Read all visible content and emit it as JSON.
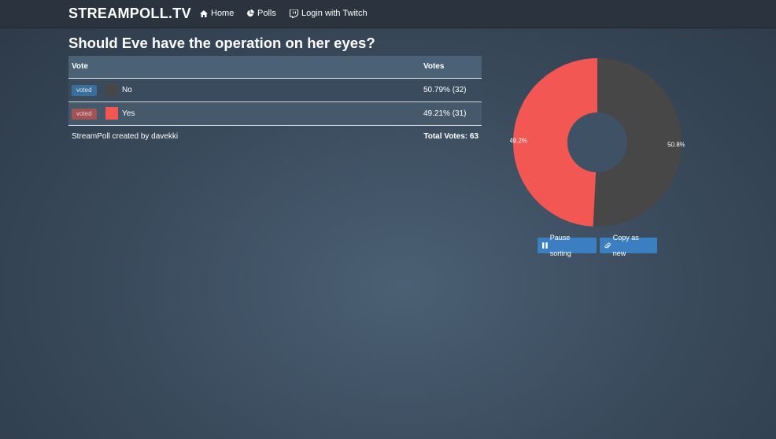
{
  "navbar": {
    "brand": "STREAMPOLL.TV",
    "links": [
      {
        "label": "Home",
        "icon": "home-icon"
      },
      {
        "label": "Polls",
        "icon": "pie-chart-icon"
      },
      {
        "label": "Login with Twitch",
        "icon": "twitch-icon"
      }
    ]
  },
  "poll": {
    "question": "Should Eve have the operation on her eyes?",
    "headers": {
      "vote": "Vote",
      "votes": "Votes"
    },
    "options": [
      {
        "badge": "voted",
        "label": "No",
        "votes": "50.79% (32)",
        "color": "#474747",
        "percent": 50.79
      },
      {
        "badge": "voted",
        "label": "Yes",
        "votes": "49.21% (31)",
        "color": "#f25754",
        "percent": 49.21
      }
    ],
    "credit": "StreamPoll created by davekki",
    "total": "Total Votes: 63"
  },
  "chart_data": {
    "type": "pie",
    "categories": [
      "No",
      "Yes"
    ],
    "values": [
      50.8,
      49.2
    ],
    "labels": [
      "50.8%",
      "49.2%"
    ],
    "colors": [
      "#474747",
      "#f25754"
    ]
  },
  "buttons": {
    "pause": "Pause sorting",
    "copy": "Copy as new"
  }
}
